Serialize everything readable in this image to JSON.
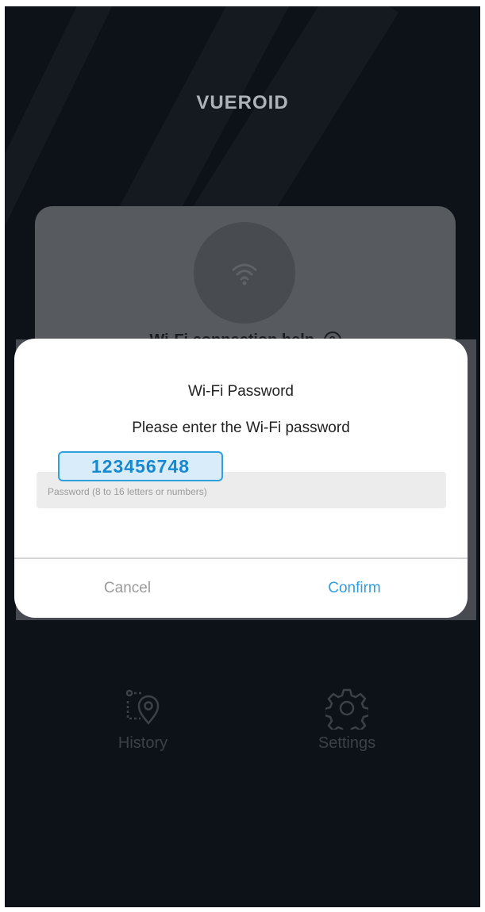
{
  "app": {
    "logo_text": "VUEROID"
  },
  "card": {
    "help_label": "Wi-Fi connection help",
    "help_icon": "question-circle-icon",
    "wifi_icon": "wifi-icon"
  },
  "dialog": {
    "title": "Wi-Fi Password",
    "message": "Please enter the Wi-Fi password",
    "password_value": "123456748",
    "password_placeholder": "Password (8 to 16 letters or numbers)",
    "cancel_label": "Cancel",
    "confirm_label": "Confirm",
    "accent_color": "#2f9fe0"
  },
  "bottom_nav": {
    "items": [
      {
        "label": "History",
        "icon": "history-location-icon"
      },
      {
        "label": "Settings",
        "icon": "gear-icon"
      }
    ]
  }
}
